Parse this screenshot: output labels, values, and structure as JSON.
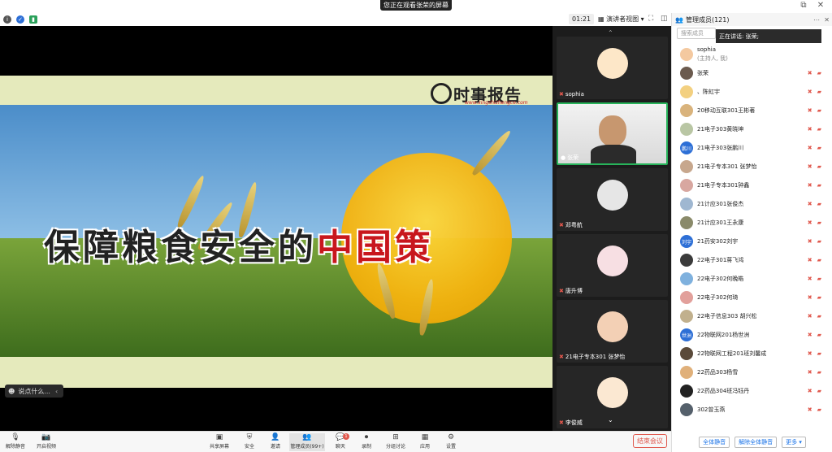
{
  "banner": {
    "text": "您正在观看张荣的屏幕"
  },
  "toolbar": {
    "time": "01:21",
    "view_label": "演讲者视图"
  },
  "slide": {
    "title_black": "保障粮食安全的",
    "title_red": "中国策",
    "logo_text": "时事报告",
    "logo_url": "www.xingshizhengce.com"
  },
  "chat_chip": {
    "text": "说点什么..."
  },
  "gallery": {
    "tiles": [
      {
        "name": "sophia"
      },
      {
        "name": "张荣"
      },
      {
        "name": "邓粤航"
      },
      {
        "name": "唐升博"
      },
      {
        "name": "21电子专本301 张梦怡"
      },
      {
        "name": "李俊威"
      }
    ]
  },
  "panel": {
    "title": "管理成员(121)",
    "search_placeholder": "搜索成员",
    "speaking": "正在讲话: 张荣;",
    "members": [
      {
        "name": "sophia",
        "role": "(主持人, 我)",
        "avatar_color": "#f4c9a0"
      },
      {
        "name": "张荣",
        "avatar_color": "#6b5a4e"
      },
      {
        "name": "、陈虹宇",
        "avatar_color": "#f3d080"
      },
      {
        "name": "20移动互联301王彬著",
        "avatar_color": "#d9b37c"
      },
      {
        "name": "21电子303黄晓坤",
        "avatar_color": "#b9c6a4"
      },
      {
        "name": "21电子303张鹏川",
        "avatar_color": "#2d6fd6",
        "avatar_text": "鹏川"
      },
      {
        "name": "21电子专本301 张梦怡",
        "avatar_color": "#c7a78d"
      },
      {
        "name": "21电子专本301钟鑫",
        "avatar_color": "#d8a7a0"
      },
      {
        "name": "21计应301张俊杰",
        "avatar_color": "#9fb7d1"
      },
      {
        "name": "21计应301王永康",
        "avatar_color": "#8a8a6a"
      },
      {
        "name": "21药安302刘宇",
        "avatar_color": "#2d6fd6",
        "avatar_text": "刘宇"
      },
      {
        "name": "22电子301蒋飞鸿",
        "avatar_color": "#3b3b3b"
      },
      {
        "name": "22电子302何晚皓",
        "avatar_color": "#7fb1de"
      },
      {
        "name": "22电子302何琦",
        "avatar_color": "#e2a09b"
      },
      {
        "name": "22电子信息303  胡兴松",
        "avatar_color": "#c1b08d"
      },
      {
        "name": "22物联网201杨世洲",
        "avatar_color": "#2d6fd6",
        "avatar_text": "世洲"
      },
      {
        "name": "22物联网工程201班刘馨成",
        "avatar_color": "#5a4a3a"
      },
      {
        "name": "22药品303杨雪",
        "avatar_color": "#e0b07a"
      },
      {
        "name": "22药品304班冯钰丹",
        "avatar_color": "#222222"
      },
      {
        "name": "302曾玉燕",
        "avatar_color": "#55606b"
      }
    ],
    "buttons": {
      "mute_all": "全体静音",
      "unmute_all": "解除全体静音",
      "more": "更多"
    }
  },
  "bottombar": {
    "items": [
      {
        "label": "解除静音",
        "icon": "mic-off-icon"
      },
      {
        "label": "开启视频",
        "icon": "video-off-icon"
      },
      {
        "label": "共享屏幕",
        "icon": "share-screen-icon"
      },
      {
        "label": "安全",
        "icon": "shield-icon"
      },
      {
        "label": "邀请",
        "icon": "invite-icon"
      },
      {
        "label": "管理成员(99+)",
        "icon": "members-icon"
      },
      {
        "label": "聊天",
        "icon": "chat-icon"
      },
      {
        "label": "录制",
        "icon": "record-icon"
      },
      {
        "label": "分组讨论",
        "icon": "breakout-icon"
      },
      {
        "label": "应用",
        "icon": "apps-icon"
      },
      {
        "label": "设置",
        "icon": "settings-icon"
      }
    ],
    "end_label": "结束会议",
    "chat_badge": "1"
  },
  "colors": {
    "accent": "#1a73e8",
    "danger": "#e0584d",
    "active_speaker": "#27b35a"
  }
}
